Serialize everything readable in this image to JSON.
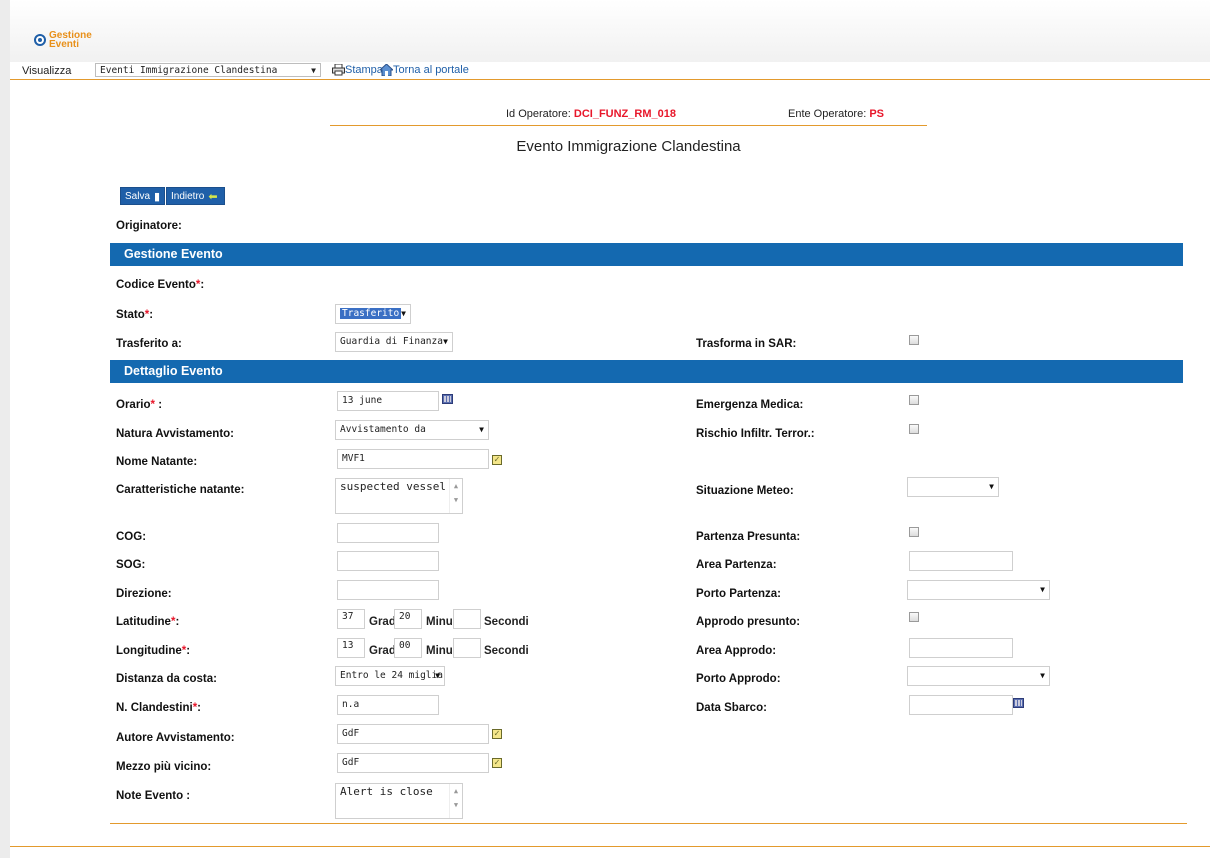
{
  "app": {
    "logo_line1": "Gestione",
    "logo_line2": "Eventi"
  },
  "menubar": {
    "visualizza_label": "Visualizza",
    "view_select": "Eventi Immigrazione Clandestina",
    "stampa": "Stampa",
    "torna": "Torna al portale"
  },
  "operator": {
    "id_label": "Id Operatore:",
    "id_value": "DCI_FUNZ_RM_018",
    "ente_label": "Ente Operatore:",
    "ente_value": "PS"
  },
  "page_title": "Evento Immigrazione Clandestina",
  "buttons": {
    "salva": "Salva",
    "indietro": "Indietro"
  },
  "originatore_label": "Originatore:",
  "sections": {
    "gestione": "Gestione Evento",
    "dettaglio": "Dettaglio Evento"
  },
  "gestione": {
    "codice_label": "Codice Evento",
    "stato_label": "Stato",
    "stato_value": "Trasferito",
    "trasferito_label": "Trasferito a:",
    "trasferito_value": "Guardia di Finanza",
    "sar_label": "Trasforma in SAR:"
  },
  "dettaglio": {
    "orario_label": "Orario",
    "orario_value": "13 june",
    "natura_label": "Natura Avvistamento:",
    "natura_value": "Avvistamento da dispositivo",
    "nome_label": "Nome Natante:",
    "nome_value": "MVF1",
    "caratteristiche_label": "Caratteristiche natante:",
    "caratteristiche_value": "suspected vessel",
    "cog_label": "COG:",
    "sog_label": "SOG:",
    "direzione_label": "Direzione:",
    "lat_label": "Latitudine",
    "lat_gradi": "37",
    "lat_minuti": "20",
    "lon_label": "Longitudine",
    "lon_gradi": "13",
    "lon_minuti": "00",
    "gradi": "Gradi",
    "minuti": "Minuti",
    "secondi": "Secondi",
    "distanza_label": "Distanza da costa:",
    "distanza_value": "Entro le 24 miglia",
    "clandestini_label": "N. Clandestini",
    "clandestini_value": "n.a",
    "autore_label": "Autore Avvistamento:",
    "autore_value": "GdF",
    "mezzo_label": "Mezzo più vicino:",
    "mezzo_value": "GdF",
    "note_label": "Note Evento :",
    "note_value": "Alert is close",
    "emergenza_label": "Emergenza Medica:",
    "rischio_label": "Rischio Infiltr. Terror.:",
    "meteo_label": "Situazione Meteo:",
    "partenza_label": "Partenza Presunta:",
    "area_partenza_label": "Area Partenza:",
    "porto_partenza_label": "Porto Partenza:",
    "approdo_label": "Approdo presunto:",
    "area_approdo_label": "Area Approdo:",
    "porto_approdo_label": "Porto Approdo:",
    "data_sbarco_label": "Data Sbarco:"
  },
  "colors": {
    "accent_blue": "#1469b0",
    "required_red": "#e8162a",
    "orange_line": "#e39a2d"
  }
}
